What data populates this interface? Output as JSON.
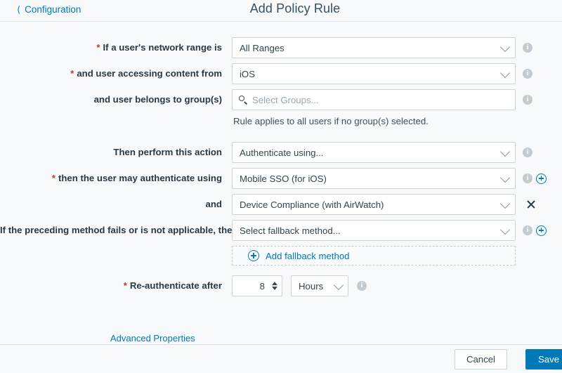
{
  "header": {
    "back_label": "Configuration",
    "back_icon": "chevron-left-icon",
    "title": "Add Policy Rule"
  },
  "form": {
    "rows": [
      {
        "label": "If a user's network range is",
        "required": true,
        "control": "select",
        "value": "All Ranges",
        "info": true
      },
      {
        "label": "and user accessing content from",
        "required": true,
        "control": "select",
        "value": "iOS",
        "info": true
      },
      {
        "label": "and user belongs to group(s)",
        "required": false,
        "control": "search",
        "placeholder": "Select Groups...",
        "info": true
      }
    ],
    "group_hint": "Rule applies to all users if no group(s) selected.",
    "action_rows": [
      {
        "label": "Then perform this action",
        "required": false,
        "value": "Authenticate using...",
        "info": true,
        "plus": false,
        "close": false
      },
      {
        "label": "then the user may authenticate using",
        "required": true,
        "value": "Mobile SSO (for iOS)",
        "info": true,
        "plus": true,
        "close": false
      },
      {
        "label": "and",
        "required": false,
        "value": "Device Compliance (with AirWatch)",
        "info": false,
        "plus": false,
        "close": true
      },
      {
        "label": "If the preceding method fails or is not applicable, then",
        "required": false,
        "value": "Select fallback method...",
        "info": true,
        "plus": true,
        "close": false
      }
    ],
    "add_fallback": {
      "label": "Add fallback method",
      "icon": "plus-circle-icon"
    },
    "reauth": {
      "label": "Re-authenticate after",
      "required": true,
      "value": "8",
      "unit": "Hours",
      "info": true
    },
    "advanced_link": "Advanced Properties"
  },
  "footer": {
    "cancel_label": "Cancel",
    "save_label": "Save"
  },
  "colors": {
    "accent": "#0079b8",
    "required": "#c0392b",
    "page_bg": "#f7f9fa",
    "border": "#cdd5da",
    "info_icon": "#c3cbd1"
  }
}
